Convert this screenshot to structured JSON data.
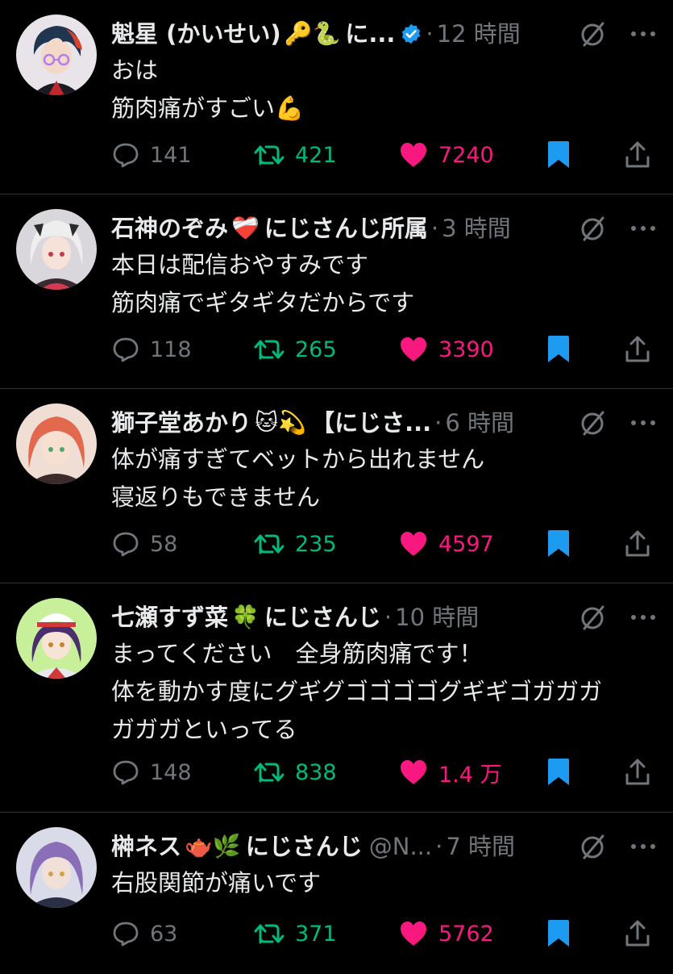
{
  "colors": {
    "background": "#000000",
    "text": "#e7e9ea",
    "muted": "#71767b",
    "retweet": "#00ba7c",
    "like": "#f91880",
    "bookmark": "#1d9bf0",
    "divider": "#2f3336"
  },
  "tweets": [
    {
      "name": "魁星 (かいせい)",
      "emoji": "🔑🐍",
      "name_tail": "に...",
      "verified": true,
      "handle": "",
      "time": "12 時間",
      "lines": [
        "おは",
        "筋肉痛がすごい💪"
      ],
      "replies": "141",
      "retweets": "421",
      "likes": "7240"
    },
    {
      "name": "石神のぞみ",
      "emoji": "❤️‍🩹",
      "name_tail": "にじさんじ所属",
      "verified": false,
      "handle": "",
      "time": "3 時間",
      "lines": [
        "本日は配信おやすみです",
        "筋肉痛でギタギタだからです"
      ],
      "replies": "118",
      "retweets": "265",
      "likes": "3390"
    },
    {
      "name": "獅子堂あかり",
      "emoji": "🐱💫",
      "name_tail": "【にじさ...",
      "verified": false,
      "handle": "",
      "time": "6 時間",
      "lines": [
        "体が痛すぎてベットから出れません",
        "寝返りもできません"
      ],
      "replies": "58",
      "retweets": "235",
      "likes": "4597"
    },
    {
      "name": "七瀬すず菜",
      "emoji": "🍀",
      "name_tail": "にじさんじ",
      "verified": false,
      "handle": "",
      "time": "10 時間",
      "lines": [
        "まってください　全身筋肉痛です！",
        "体を動かす度にグギグゴゴゴゴグギギゴガガガ",
        "ガガガといってる"
      ],
      "replies": "148",
      "retweets": "838",
      "likes": "1.4 万"
    },
    {
      "name": "榊ネス",
      "emoji": "🫖🌿",
      "name_tail": "にじさんじ",
      "verified": false,
      "handle": "@N...",
      "time": "7 時間",
      "lines": [
        "右股関節が痛いです"
      ],
      "replies": "63",
      "retweets": "371",
      "likes": "5762"
    }
  ]
}
